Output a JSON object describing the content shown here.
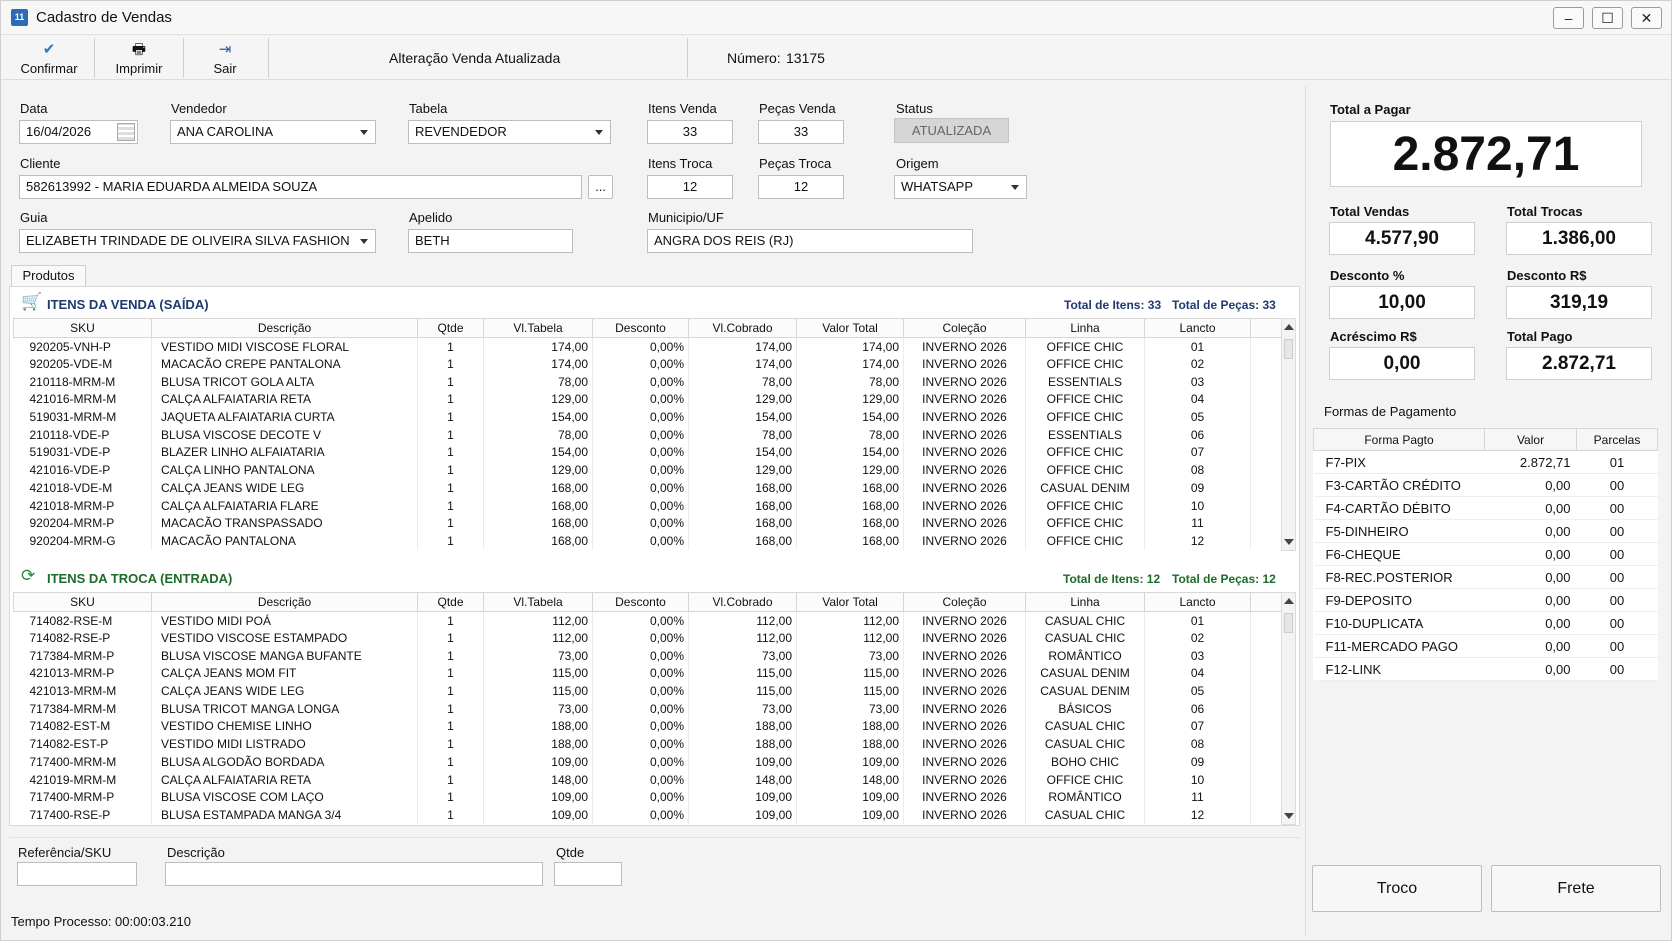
{
  "window": {
    "title": "Cadastro de Vendas",
    "controls": [
      "–",
      "☐",
      "✕"
    ]
  },
  "toolbar": {
    "confirm_label": "Confirmar",
    "print_label": "Imprimir",
    "exit_label": "Sair",
    "message": "Alteração Venda Atualizada",
    "number_label": "Número:",
    "number_value": "13175"
  },
  "form": {
    "data_label": "Data",
    "data_value": "16/04/2026",
    "vendedor_label": "Vendedor",
    "vendedor_value": "ANA CAROLINA",
    "tabela_label": "Tabela",
    "tabela_value": "REVENDEDOR",
    "itens_venda_label": "Itens Venda",
    "itens_venda_value": "33",
    "pecas_venda_label": "Peças Venda",
    "pecas_venda_value": "33",
    "status_label": "Status",
    "status_value": "ATUALIZADA",
    "cliente_label": "Cliente",
    "cliente_value": "582613992  -  MARIA EDUARDA ALMEIDA SOUZA",
    "cliente_btn": "...",
    "itens_troca_label": "Itens Troca",
    "itens_troca_value": "12",
    "pecas_troca_label": "Peças Troca",
    "pecas_troca_value": "12",
    "origem_label": "Origem",
    "origem_value": "WHATSAPP",
    "guia_label": "Guia",
    "guia_value": "ELIZABETH TRINDADE DE OLIVEIRA SILVA FASHION",
    "apelido_label": "Apelido",
    "apelido_value": "BETH",
    "municipio_label": "Municipio/UF",
    "municipio_value": "ANGRA DOS REIS (RJ)"
  },
  "tab_label": "Produtos",
  "columns": [
    "SKU",
    "Descrição",
    "Qtde",
    "Vl.Tabela",
    "Desconto",
    "Vl.Cobrado",
    "Valor Total",
    "Coleção",
    "Linha",
    "Lancto"
  ],
  "sale": {
    "title": "ITENS DA VENDA (SAÍDA)",
    "total_itens": "Total de Itens: 33",
    "total_pecas": "Total de Peças: 33",
    "rows": [
      [
        "920205-VNH-P",
        "VESTIDO MIDI VISCOSE FLORAL",
        "1",
        "174,00",
        "0,00%",
        "174,00",
        "174,00",
        "INVERNO 2026",
        "OFFICE CHIC",
        "01"
      ],
      [
        "920205-VDE-M",
        "MACACÃO CREPE PANTALONA",
        "1",
        "174,00",
        "0,00%",
        "174,00",
        "174,00",
        "INVERNO 2026",
        "OFFICE CHIC",
        "02"
      ],
      [
        "210118-MRM-M",
        "BLUSA TRICOT GOLA ALTA",
        "1",
        "78,00",
        "0,00%",
        "78,00",
        "78,00",
        "INVERNO 2026",
        "ESSENTIALS",
        "03"
      ],
      [
        "421016-MRM-M",
        "CALÇA ALFAIATARIA RETA",
        "1",
        "129,00",
        "0,00%",
        "129,00",
        "129,00",
        "INVERNO 2026",
        "OFFICE CHIC",
        "04"
      ],
      [
        "519031-MRM-M",
        "JAQUETA ALFAIATARIA CURTA",
        "1",
        "154,00",
        "0,00%",
        "154,00",
        "154,00",
        "INVERNO 2026",
        "OFFICE CHIC",
        "05"
      ],
      [
        "210118-VDE-P",
        "BLUSA VISCOSE DECOTE V",
        "1",
        "78,00",
        "0,00%",
        "78,00",
        "78,00",
        "INVERNO 2026",
        "ESSENTIALS",
        "06"
      ],
      [
        "519031-VDE-P",
        "BLAZER LINHO ALFAIATARIA",
        "1",
        "154,00",
        "0,00%",
        "154,00",
        "154,00",
        "INVERNO 2026",
        "OFFICE CHIC",
        "07"
      ],
      [
        "421016-VDE-P",
        "CALÇA LINHO PANTALONA",
        "1",
        "129,00",
        "0,00%",
        "129,00",
        "129,00",
        "INVERNO 2026",
        "OFFICE CHIC",
        "08"
      ],
      [
        "421018-VDE-M",
        "CALÇA JEANS WIDE LEG",
        "1",
        "168,00",
        "0,00%",
        "168,00",
        "168,00",
        "INVERNO 2026",
        "CASUAL DENIM",
        "09"
      ],
      [
        "421018-MRM-P",
        "CALÇA ALFAIATARIA FLARE",
        "1",
        "168,00",
        "0,00%",
        "168,00",
        "168,00",
        "INVERNO 2026",
        "OFFICE CHIC",
        "10"
      ],
      [
        "920204-MRM-P",
        "MACACÃO TRANSPASSADO",
        "1",
        "168,00",
        "0,00%",
        "168,00",
        "168,00",
        "INVERNO 2026",
        "OFFICE CHIC",
        "11"
      ],
      [
        "920204-MRM-G",
        "MACACÃO PANTALONA",
        "1",
        "168,00",
        "0,00%",
        "168,00",
        "168,00",
        "INVERNO 2026",
        "OFFICE CHIC",
        "12"
      ]
    ]
  },
  "trade": {
    "title": "ITENS DA TROCA (ENTRADA)",
    "total_itens": "Total de Itens: 12",
    "total_pecas": "Total de Peças: 12",
    "rows": [
      [
        "714082-RSE-M",
        "VESTIDO MIDI POÁ",
        "1",
        "112,00",
        "0,00%",
        "112,00",
        "112,00",
        "INVERNO 2026",
        "CASUAL CHIC",
        "01"
      ],
      [
        "714082-RSE-P",
        "VESTIDO VISCOSE ESTAMPADO",
        "1",
        "112,00",
        "0,00%",
        "112,00",
        "112,00",
        "INVERNO 2026",
        "CASUAL CHIC",
        "02"
      ],
      [
        "717384-MRM-P",
        "BLUSA VISCOSE MANGA BUFANTE",
        "1",
        "73,00",
        "0,00%",
        "73,00",
        "73,00",
        "INVERNO 2026",
        "ROMÂNTICO",
        "03"
      ],
      [
        "421013-MRM-P",
        "CALÇA JEANS MOM FIT",
        "1",
        "115,00",
        "0,00%",
        "115,00",
        "115,00",
        "INVERNO 2026",
        "CASUAL DENIM",
        "04"
      ],
      [
        "421013-MRM-M",
        "CALÇA JEANS WIDE LEG",
        "1",
        "115,00",
        "0,00%",
        "115,00",
        "115,00",
        "INVERNO 2026",
        "CASUAL DENIM",
        "05"
      ],
      [
        "717384-MRM-M",
        "BLUSA TRICOT MANGA LONGA",
        "1",
        "73,00",
        "0,00%",
        "73,00",
        "73,00",
        "INVERNO 2026",
        "BÁSICOS",
        "06"
      ],
      [
        "714082-EST-M",
        "VESTIDO CHEMISE LINHO",
        "1",
        "188,00",
        "0,00%",
        "188,00",
        "188,00",
        "INVERNO 2026",
        "CASUAL CHIC",
        "07"
      ],
      [
        "714082-EST-P",
        "VESTIDO MIDI LISTRADO",
        "1",
        "188,00",
        "0,00%",
        "188,00",
        "188,00",
        "INVERNO 2026",
        "CASUAL CHIC",
        "08"
      ],
      [
        "717400-MRM-M",
        "BLUSA ALGODÃO BORDADA",
        "1",
        "109,00",
        "0,00%",
        "109,00",
        "109,00",
        "INVERNO 2026",
        "BOHO CHIC",
        "09"
      ],
      [
        "421019-MRM-M",
        "CALÇA ALFAIATARIA RETA",
        "1",
        "148,00",
        "0,00%",
        "148,00",
        "148,00",
        "INVERNO 2026",
        "OFFICE CHIC",
        "10"
      ],
      [
        "717400-MRM-P",
        "BLUSA VISCOSE COM LAÇO",
        "1",
        "109,00",
        "0,00%",
        "109,00",
        "109,00",
        "INVERNO 2026",
        "ROMÂNTICO",
        "11"
      ],
      [
        "717400-RSE-P",
        "BLUSA ESTAMPADA MANGA 3/4",
        "1",
        "109,00",
        "0,00%",
        "109,00",
        "109,00",
        "INVERNO 2026",
        "CASUAL CHIC",
        "12"
      ]
    ]
  },
  "entry": {
    "ref_label": "Referência/SKU",
    "desc_label": "Descrição",
    "qtde_label": "Qtde"
  },
  "status_bar": "Tempo Processo: 00:00:03.210",
  "summary": {
    "total_pagar_label": "Total a Pagar",
    "total_pagar": "2.872,71",
    "total_vendas_label": "Total Vendas",
    "total_vendas": "4.577,90",
    "total_trocas_label": "Total Trocas",
    "total_trocas": "1.386,00",
    "desconto_pct_label": "Desconto %",
    "desconto_pct": "10,00",
    "desconto_rs_label": "Desconto R$",
    "desconto_rs": "319,19",
    "acrescimo_label": "Acréscimo R$",
    "acrescimo": "0,00",
    "total_pago_label": "Total Pago",
    "total_pago": "2.872,71"
  },
  "payments": {
    "title": "Formas de Pagamento",
    "headers": [
      "Forma Pagto",
      "Valor",
      "Parcelas"
    ],
    "rows": [
      [
        "F7-PIX",
        "2.872,71",
        "01"
      ],
      [
        "F3-CARTÃO CRÉDITO",
        "0,00",
        "00"
      ],
      [
        "F4-CARTÃO DÉBITO",
        "0,00",
        "00"
      ],
      [
        "F5-DINHEIRO",
        "0,00",
        "00"
      ],
      [
        "F6-CHEQUE",
        "0,00",
        "00"
      ],
      [
        "F8-REC.POSTERIOR",
        "0,00",
        "00"
      ],
      [
        "F9-DEPOSITO",
        "0,00",
        "00"
      ],
      [
        "F10-DUPLICATA",
        "0,00",
        "00"
      ],
      [
        "F11-MERCADO PAGO",
        "0,00",
        "00"
      ],
      [
        "F12-LINK",
        "0,00",
        "00"
      ]
    ]
  },
  "buttons": {
    "troco": "Troco",
    "frete": "Frete"
  },
  "colors": {
    "sale_title": "#1f3a6e",
    "trade_title": "#1e6b2a",
    "check_icon": "#3a73b8"
  }
}
